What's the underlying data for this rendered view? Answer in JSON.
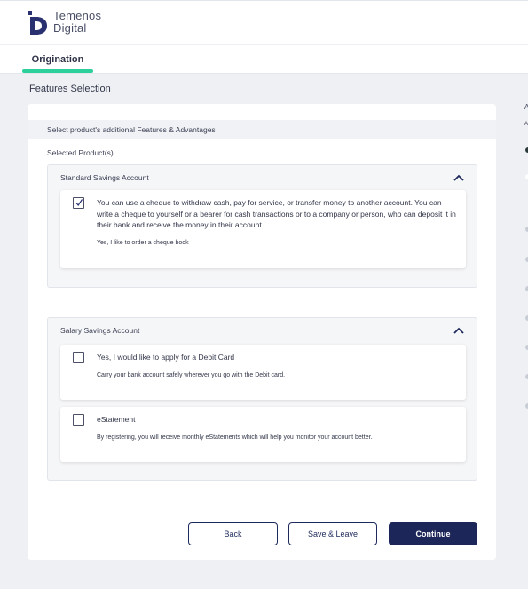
{
  "header": {
    "brand_line1": "Temenos",
    "brand_line2": "Digital"
  },
  "tabs": [
    {
      "label": "Origination",
      "active": true
    }
  ],
  "page": {
    "title": "Features Selection"
  },
  "card": {
    "heading": "Select product's additional Features & Advantages",
    "selected_label": "Selected Product(s)"
  },
  "products": [
    {
      "name": "Standard Savings Account",
      "features": [
        {
          "checked": true,
          "text": "You can use a cheque to withdraw cash, pay for service, or transfer money to another account. You can write a cheque to yourself or a bearer for cash transactions or to a company or person, who can deposit it in their bank and receive the money in their account",
          "sub": "Yes, I like to order a cheque book"
        }
      ]
    },
    {
      "name": "Salary Savings Account",
      "features": [
        {
          "checked": false,
          "text": "Yes, I would like to apply for a Debit Card",
          "sub": "Carry your bank account safely wherever you go with the Debit card."
        },
        {
          "checked": false,
          "text": "eStatement",
          "sub": "By registering, you will receive monthly eStatements which will help you monitor your account better."
        }
      ]
    }
  ],
  "actions": {
    "back": "Back",
    "save": "Save & Leave",
    "continue": "Continue"
  },
  "colors": {
    "accent": "#2dcf9a",
    "primary": "#1c2659",
    "logo": "#2a3170"
  },
  "right_panel_fragments": [
    "A",
    "A"
  ]
}
